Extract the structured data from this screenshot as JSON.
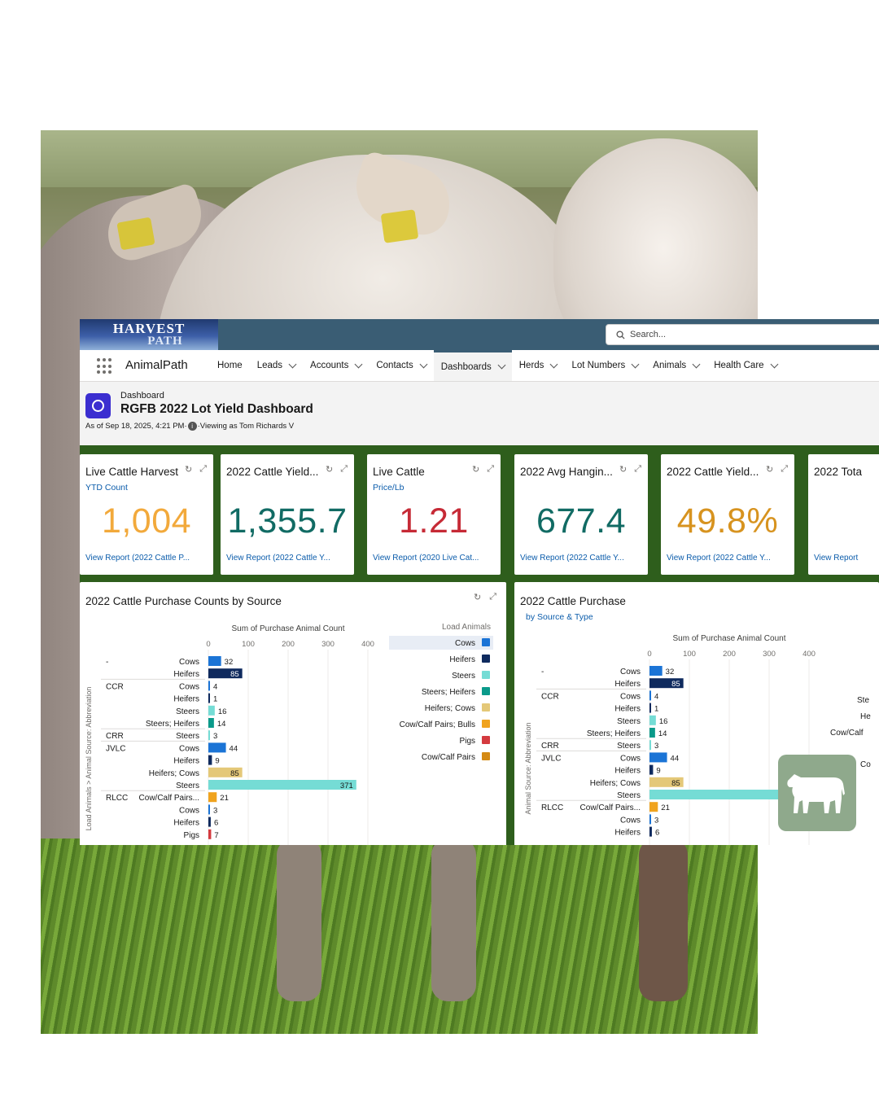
{
  "header_bar": {
    "logo_line1": "HARVEST",
    "logo_line2": "PATH",
    "search_placeholder": "Search..."
  },
  "nav": {
    "app_name": "AnimalPath",
    "items": [
      {
        "label": "Home",
        "chevron": false,
        "active": false
      },
      {
        "label": "Leads",
        "chevron": true,
        "active": false
      },
      {
        "label": "Accounts",
        "chevron": true,
        "active": false
      },
      {
        "label": "Contacts",
        "chevron": true,
        "active": false
      },
      {
        "label": "Dashboards",
        "chevron": true,
        "active": true
      },
      {
        "label": "Herds",
        "chevron": true,
        "active": false
      },
      {
        "label": "Lot Numbers",
        "chevron": true,
        "active": false
      },
      {
        "label": "Animals",
        "chevron": true,
        "active": false
      },
      {
        "label": "Health Care",
        "chevron": true,
        "active": false
      }
    ]
  },
  "dashboard": {
    "kicker": "Dashboard",
    "title": "RGFB 2022 Lot Yield Dashboard",
    "as_of": "As of Sep 18, 2025, 4:21 PM·",
    "viewing_as": "·Viewing as Tom Richards V"
  },
  "kpis": [
    {
      "title": "Live Cattle Harvest",
      "subtitle": "YTD Count",
      "value": "1,004",
      "color": "#f2a93b",
      "link": "View Report (2022 Cattle P..."
    },
    {
      "title": "2022 Cattle Yield...",
      "subtitle": "",
      "value": "1,355.7",
      "color": "#116b64",
      "link": "View Report (2022 Cattle Y..."
    },
    {
      "title": "Live Cattle",
      "subtitle": "Price/Lb",
      "value": "1.21",
      "color": "#c62a36",
      "link": "View Report (2020 Live Cat..."
    },
    {
      "title": "2022 Avg Hangin...",
      "subtitle": "",
      "value": "677.4",
      "color": "#116b64",
      "link": "View Report (2022 Cattle Y..."
    },
    {
      "title": "2022 Cattle Yield...",
      "subtitle": "",
      "value": "49.8%",
      "color": "#d7931f",
      "link": "View Report (2022 Cattle Y..."
    },
    {
      "title": "2022 Tota",
      "subtitle": "",
      "value": "",
      "color": "#181818",
      "link": "View Report"
    }
  ],
  "chart_panels": [
    {
      "title": "2022 Cattle Purchase Counts by Source",
      "subtitle": ""
    },
    {
      "title": "2022 Cattle Purchase",
      "subtitle": "by Source & Type"
    }
  ],
  "chart_data": [
    {
      "type": "bar",
      "orientation": "horizontal",
      "title": "2022 Cattle Purchase Counts by Source",
      "xlabel": "Sum of Purchase Animal Count",
      "ylabel": "Load Animals > Animal Source: Abbreviation",
      "xlim": [
        0,
        400
      ],
      "xticks": [
        "0",
        "100",
        "200",
        "300",
        "400"
      ],
      "legend_title": "Load Animals",
      "legend": [
        {
          "label": "Cows",
          "color": "#1b74d6"
        },
        {
          "label": "Heifers",
          "color": "#0f2a5e"
        },
        {
          "label": "Steers",
          "color": "#75dcd5"
        },
        {
          "label": "Steers; Heifers",
          "color": "#0a9a8a"
        },
        {
          "label": "Heifers; Cows",
          "color": "#e4c878"
        },
        {
          "label": "Cow/Calf Pairs; Bulls",
          "color": "#f0a31e"
        },
        {
          "label": "Pigs",
          "color": "#d43a3f"
        },
        {
          "label": "Cow/Calf Pairs",
          "color": "#d48a14"
        }
      ],
      "rows": [
        {
          "group": "-",
          "category": "Cows",
          "value": 32
        },
        {
          "group": "",
          "category": "Heifers",
          "value": 85
        },
        {
          "group": "CCR",
          "category": "Cows",
          "value": 4
        },
        {
          "group": "",
          "category": "Heifers",
          "value": 1
        },
        {
          "group": "",
          "category": "Steers",
          "value": 16
        },
        {
          "group": "",
          "category": "Steers; Heifers",
          "value": 14
        },
        {
          "group": "CRR",
          "category": "Steers",
          "value": 3
        },
        {
          "group": "JVLC",
          "category": "Cows",
          "value": 44
        },
        {
          "group": "",
          "category": "Heifers",
          "value": 9
        },
        {
          "group": "",
          "category": "Heifers; Cows",
          "value": 85
        },
        {
          "group": "",
          "category": "Steers",
          "value": 371
        },
        {
          "group": "RLCC",
          "category": "Cow/Calf Pairs...",
          "value": 21
        },
        {
          "group": "",
          "category": "Cows",
          "value": 3
        },
        {
          "group": "",
          "category": "Heifers",
          "value": 6
        },
        {
          "group": "",
          "category": "Pigs",
          "value": 7
        }
      ]
    },
    {
      "type": "bar",
      "orientation": "horizontal",
      "title": "2022 Cattle Purchase",
      "subtitle": "by Source & Type",
      "xlabel": "Sum of Purchase Animal Count",
      "ylabel": "Animal Source: Abbreviation",
      "xlim": [
        0,
        400
      ],
      "xticks": [
        "0",
        "100",
        "200",
        "300",
        "400"
      ],
      "legend": [
        {
          "label": "Ste",
          "color": "#75dcd5"
        },
        {
          "label": "He",
          "color": "#0f2a5e"
        },
        {
          "label": "Cow/Calf",
          "color": "#f0a31e"
        },
        {
          "label": "Co",
          "color": "#1b74d6"
        }
      ],
      "rows": [
        {
          "group": "-",
          "category": "Cows",
          "value": 32
        },
        {
          "group": "",
          "category": "Heifers",
          "value": 85
        },
        {
          "group": "CCR",
          "category": "Cows",
          "value": 4
        },
        {
          "group": "",
          "category": "Heifers",
          "value": 1
        },
        {
          "group": "",
          "category": "Steers",
          "value": 16
        },
        {
          "group": "",
          "category": "Steers; Heifers",
          "value": 14
        },
        {
          "group": "CRR",
          "category": "Steers",
          "value": 3
        },
        {
          "group": "JVLC",
          "category": "Cows",
          "value": 44
        },
        {
          "group": "",
          "category": "Heifers",
          "value": 9
        },
        {
          "group": "",
          "category": "Heifers; Cows",
          "value": 85
        },
        {
          "group": "",
          "category": "Steers",
          "value": 371
        },
        {
          "group": "RLCC",
          "category": "Cow/Calf Pairs...",
          "value": 21
        },
        {
          "group": "",
          "category": "Cows",
          "value": 3
        },
        {
          "group": "",
          "category": "Heifers",
          "value": 6
        }
      ]
    }
  ],
  "colors": {
    "accent": "#3a5d74",
    "link": "#0b5cab",
    "canvas": "#2e5e1c",
    "badge": "#8fa98c"
  },
  "icons": [
    "search-icon",
    "app-launcher-icon",
    "dashboard-icon",
    "info-icon",
    "refresh-icon",
    "expand-icon",
    "cow-icon"
  ]
}
